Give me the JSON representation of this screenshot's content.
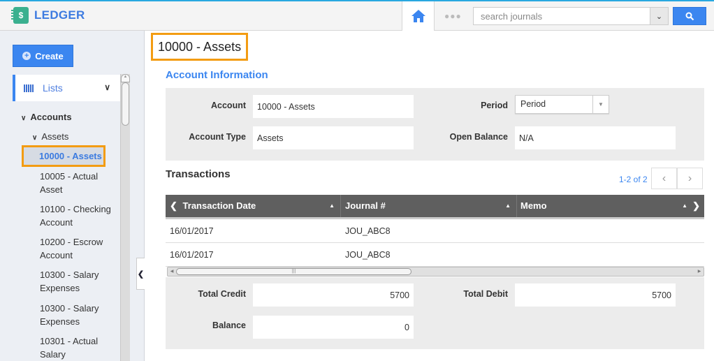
{
  "app": {
    "name": "LEDGER",
    "brand_color": "#3d7be0",
    "accent_color": "#3b86f0",
    "highlight_color": "#f39c12"
  },
  "topbar": {
    "home_icon": "home-icon",
    "more_icon": "more-dots-icon",
    "search": {
      "placeholder": "search journals",
      "value": ""
    },
    "search_button_icon": "search-icon"
  },
  "sidebar": {
    "create_label": "Create",
    "lists_label": "Lists",
    "tree": [
      {
        "label": "Accounts",
        "level": 0,
        "expanded": true
      },
      {
        "label": "Assets",
        "level": 1,
        "expanded": true
      },
      {
        "label": "10000 - Assets",
        "level": 2,
        "selected": true
      },
      {
        "label_line1": "10005 - Actual",
        "label_line2": "Asset",
        "level": 2
      },
      {
        "label_line1": "10100 - Checking",
        "label_line2": "Account",
        "level": 2
      },
      {
        "label_line1": "10200 - Escrow",
        "label_line2": "Account",
        "level": 2
      },
      {
        "label_line1": "10300 - Salary",
        "label_line2": "Expenses",
        "level": 2
      },
      {
        "label_line1": "10300 - Salary",
        "label_line2": "Expenses",
        "level": 2
      },
      {
        "label_line1": "10301 - Actual",
        "label_line2": "Salary",
        "level": 2
      }
    ]
  },
  "main": {
    "page_title": "10000 - Assets",
    "account_info": {
      "title": "Account Information",
      "account_label": "Account",
      "account_value": "10000 - Assets",
      "account_type_label": "Account Type",
      "account_type_value": "Assets",
      "period_label": "Period",
      "period_value": "Period",
      "open_balance_label": "Open Balance",
      "open_balance_value": "N/A"
    },
    "transactions": {
      "title": "Transactions",
      "pager": "1-2 of 2",
      "columns": [
        "Transaction Date",
        "Journal #",
        "Memo"
      ],
      "rows": [
        {
          "date": "16/01/2017",
          "journal": "JOU_ABC8",
          "memo": ""
        },
        {
          "date": "16/01/2017",
          "journal": "JOU_ABC8",
          "memo": ""
        }
      ]
    },
    "totals": {
      "total_credit_label": "Total Credit",
      "total_credit_value": "5700",
      "total_debit_label": "Total Debit",
      "total_debit_value": "5700",
      "balance_label": "Balance",
      "balance_value": "0"
    }
  }
}
